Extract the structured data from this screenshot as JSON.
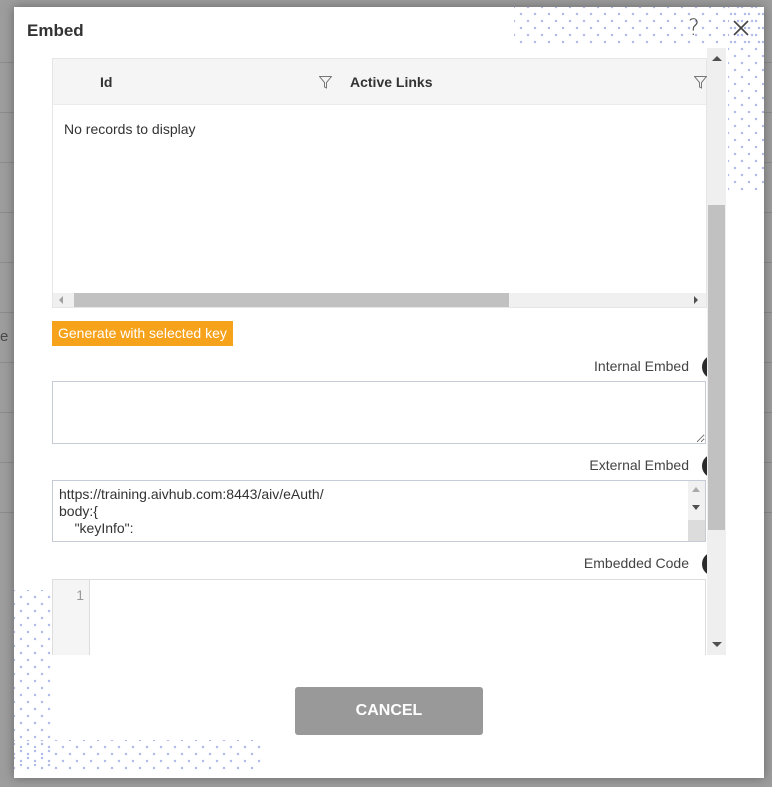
{
  "background": {
    "partial_text": "e"
  },
  "dialog": {
    "title": "Embed",
    "help_icon": "question-mark-icon",
    "close_icon": "close-icon"
  },
  "grid": {
    "columns": [
      {
        "label": "Id",
        "filter_icon": "filter-icon"
      },
      {
        "label": "Active Links",
        "filter_icon": "filter-icon"
      }
    ],
    "empty_message": "No records to display",
    "horizontal_scroll_fraction": 0.67
  },
  "generate_button": {
    "label": "Generate with selected key",
    "color": "#f7a21b"
  },
  "fields": {
    "internal": {
      "label": "Internal Embed",
      "value": "",
      "copy_icon": "copy-icon"
    },
    "external": {
      "label": "External Embed",
      "value": "https://training.aivhub.com:8443/aiv/eAuth/\nbody:{\n    \"keyInfo\":",
      "copy_icon": "copy-icon"
    },
    "embedded_code": {
      "label": "Embedded Code",
      "line_numbers": [
        "1"
      ],
      "value": "",
      "copy_icon": "copy-icon"
    }
  },
  "footer": {
    "cancel_label": "CANCEL"
  }
}
